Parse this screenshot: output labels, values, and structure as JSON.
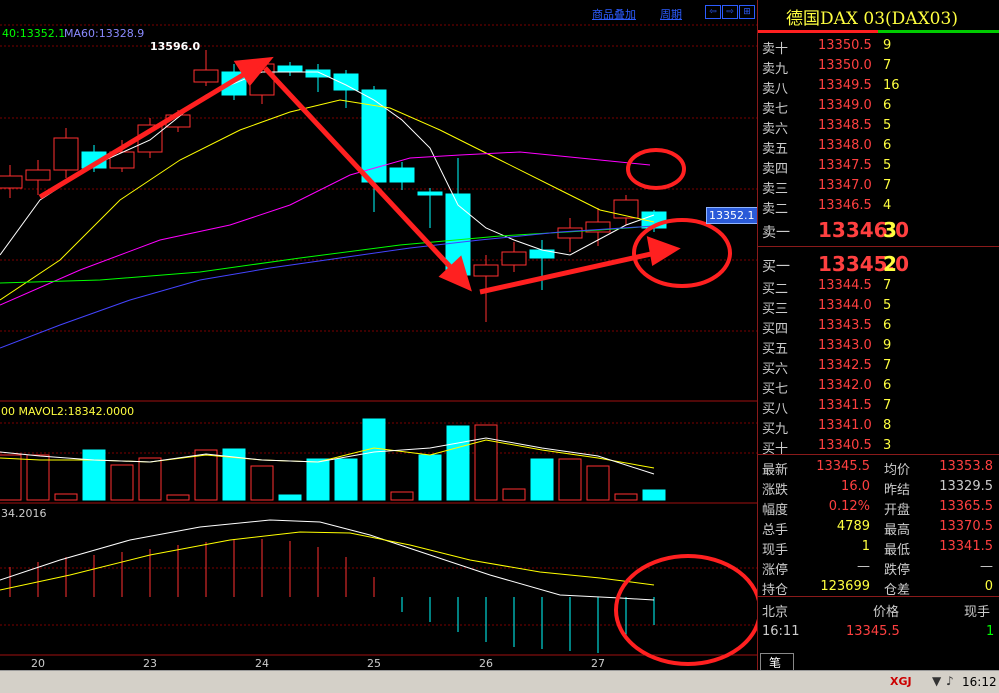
{
  "header": {
    "product_overlay": "商品叠加",
    "period": "周期",
    "ma_text_a": "40:13352.1",
    "ma_text_b": "MA60:13328.9",
    "high_label": "13596.0",
    "current_price_tag": "13352.1",
    "volume_label": "00  MAVOL2:18342.0000",
    "macd_label": "34.2016"
  },
  "chart_data": {
    "type": "candlestick",
    "x_tick_labels": [
      "20",
      "23",
      "24",
      "25",
      "26",
      "27"
    ],
    "price_marks": [
      13596.0,
      13352.1
    ],
    "ma_values": {
      "ma40": 13352.1,
      "ma60": 13328.9
    },
    "mavol2": 18342.0,
    "macd_value": 34.2016
  },
  "quote": {
    "title": "德国DAX 03(DAX03)",
    "asks": [
      {
        "label": "卖十",
        "price": "13350.5",
        "vol": "9"
      },
      {
        "label": "卖九",
        "price": "13350.0",
        "vol": "7"
      },
      {
        "label": "卖八",
        "price": "13349.5",
        "vol": "16"
      },
      {
        "label": "卖七",
        "price": "13349.0",
        "vol": "6"
      },
      {
        "label": "卖六",
        "price": "13348.5",
        "vol": "5"
      },
      {
        "label": "卖五",
        "price": "13348.0",
        "vol": "6"
      },
      {
        "label": "卖四",
        "price": "13347.5",
        "vol": "5"
      },
      {
        "label": "卖三",
        "price": "13347.0",
        "vol": "7"
      },
      {
        "label": "卖二",
        "price": "13346.5",
        "vol": "4"
      }
    ],
    "ask1": {
      "label": "卖一",
      "price": "13346.0",
      "vol": "3"
    },
    "bid1": {
      "label": "买一",
      "price": "13345.0",
      "vol": "2"
    },
    "bids": [
      {
        "label": "买二",
        "price": "13344.5",
        "vol": "7"
      },
      {
        "label": "买三",
        "price": "13344.0",
        "vol": "5"
      },
      {
        "label": "买四",
        "price": "13343.5",
        "vol": "6"
      },
      {
        "label": "买五",
        "price": "13343.0",
        "vol": "9"
      },
      {
        "label": "买六",
        "price": "13342.5",
        "vol": "7"
      },
      {
        "label": "买七",
        "price": "13342.0",
        "vol": "6"
      },
      {
        "label": "买八",
        "price": "13341.5",
        "vol": "7"
      },
      {
        "label": "买九",
        "price": "13341.0",
        "vol": "8"
      },
      {
        "label": "买十",
        "price": "13340.5",
        "vol": "3"
      }
    ],
    "stats": [
      {
        "l1": "最新",
        "v1": "13345.5",
        "c1": "#ff4040",
        "l2": "均价",
        "v2": "13353.8",
        "c2": "#ff4040"
      },
      {
        "l1": "涨跌",
        "v1": "16.0",
        "c1": "#ff4040",
        "l2": "昨结",
        "v2": "13329.5",
        "c2": "#cccccc"
      },
      {
        "l1": "幅度",
        "v1": "0.12%",
        "c1": "#ff4040",
        "l2": "开盘",
        "v2": "13365.5",
        "c2": "#ff4040"
      },
      {
        "l1": "总手",
        "v1": "4789",
        "c1": "#ffff40",
        "l2": "最高",
        "v2": "13370.5",
        "c2": "#ff4040"
      },
      {
        "l1": "现手",
        "v1": "1",
        "c1": "#ffff40",
        "l2": "最低",
        "v2": "13341.5",
        "c2": "#ff4040"
      },
      {
        "l1": "涨停",
        "v1": "—",
        "c1": "#cccccc",
        "l2": "跌停",
        "v2": "—",
        "c2": "#cccccc"
      },
      {
        "l1": "持仓",
        "v1": "123699",
        "c1": "#ffff40",
        "l2": "仓差",
        "v2": "0",
        "c2": "#ffff40"
      }
    ],
    "ticks_header": {
      "time": "北京",
      "price": "价格",
      "vol": "现手"
    },
    "tick_row": {
      "time": "16:11",
      "price": "13345.5",
      "vol": "1"
    },
    "tab_label": "笔"
  },
  "status": {
    "brand": "XGJ",
    "time": "16:12"
  },
  "colors": {
    "up": "#ff3030",
    "down": "#00ffff",
    "ma_white": "#ffffff",
    "ma_yellow": "#ffff00",
    "ma_magenta": "#ff00ff",
    "ma_green": "#00ff00",
    "ma_blue": "#4444ff"
  }
}
